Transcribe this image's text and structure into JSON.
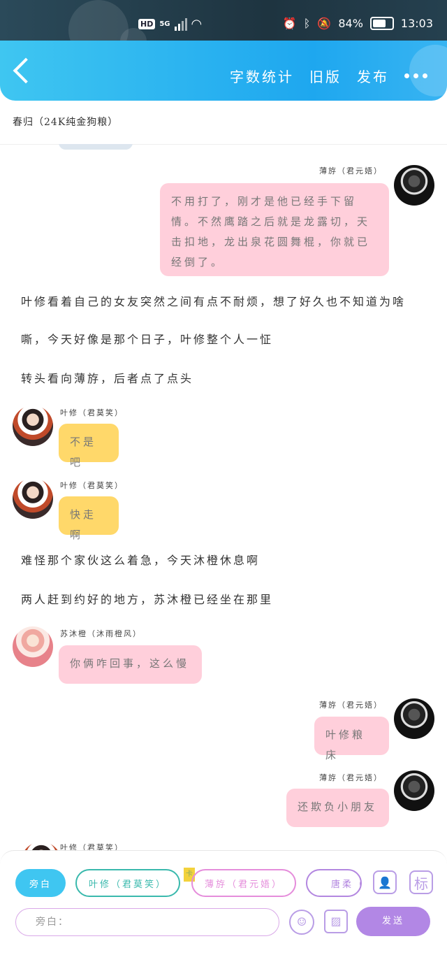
{
  "status_bar": {
    "network": "HD",
    "signal": "5G",
    "battery": "84%",
    "battery_level": 0.84,
    "time": "13:03"
  },
  "header": {
    "back_icon": "chevron-left-icon",
    "actions": [
      "字数统计",
      "旧版",
      "发布"
    ],
    "more_icon": "more-horizontal-icon"
  },
  "story_title": "春归（24K纯金狗粮）",
  "messages": [
    {
      "type": "right",
      "name": "薄斿（君元娪）",
      "text": "不用打了，刚才是他已经手下留情。不然鹰踏之后就是龙露切，天击扣地，龙出泉花圆舞棍，你就已经倒了。"
    },
    {
      "type": "narration",
      "text": "叶修看着自己的女友突然之间有点不耐烦，想了好久也不知道为啥"
    },
    {
      "type": "narration",
      "text": "嘶，今天好像是那个日子，叶修整个人一怔"
    },
    {
      "type": "narration",
      "text": "转头看向薄斿，后者点了点头"
    },
    {
      "type": "left",
      "name": "叶修（君莫笑）",
      "text": "不是吧"
    },
    {
      "type": "left",
      "name": "叶修（君莫笑）",
      "text": "快走啊"
    },
    {
      "type": "narration",
      "text": "难怪那个家伙这么着急，今天沐橙休息啊"
    },
    {
      "type": "narration",
      "text": "两人赶到约好的地方，苏沐橙已经坐在那里"
    },
    {
      "type": "left",
      "name": "苏沐橙（沐雨橙风）",
      "text": "你俩咋回事，这么慢"
    },
    {
      "type": "right",
      "name": "薄斿（君元娪）",
      "text": "叶修粮床"
    },
    {
      "type": "right",
      "name": "薄斿（君元娪）",
      "text": "还欺负小朋友"
    },
    {
      "type": "left",
      "name": "叶修（君莫笑）",
      "text": ""
    }
  ],
  "composer": {
    "roles": [
      "旁白",
      "叶修（君莫笑）",
      "薄斿（君元娪）",
      "唐柔（寒"
    ],
    "note_badge": "卡",
    "input_placeholder": "旁白：",
    "send_label": "发送",
    "tag_label": "标"
  }
}
